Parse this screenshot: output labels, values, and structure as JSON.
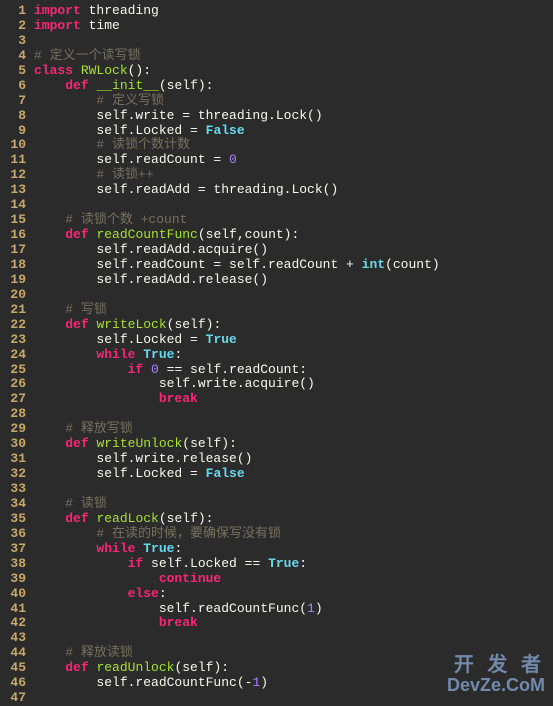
{
  "watermark": {
    "line1": "开 发 者",
    "line2": "DevZe.CoM"
  },
  "lines": [
    {
      "n": 1,
      "tokens": [
        [
          "import",
          "tok-import"
        ],
        [
          " threading",
          "tok-id"
        ]
      ]
    },
    {
      "n": 2,
      "tokens": [
        [
          "import",
          "tok-import"
        ],
        [
          " time",
          "tok-id"
        ]
      ]
    },
    {
      "n": 3,
      "tokens": []
    },
    {
      "n": 4,
      "tokens": [
        [
          "# 定义一个读写锁",
          "tok-comment"
        ]
      ]
    },
    {
      "n": 5,
      "tokens": [
        [
          "class ",
          "tok-deco"
        ],
        [
          "RWLock",
          "tok-def"
        ],
        [
          "():",
          "tok-paren"
        ]
      ]
    },
    {
      "n": 6,
      "tokens": [
        [
          "    ",
          ""
        ],
        [
          "def ",
          "tok-deco"
        ],
        [
          "__init__",
          "tok-def"
        ],
        [
          "(self):",
          "tok-paren"
        ]
      ]
    },
    {
      "n": 7,
      "tokens": [
        [
          "        ",
          ""
        ],
        [
          "# 定义写锁",
          "tok-comment"
        ]
      ]
    },
    {
      "n": 8,
      "tokens": [
        [
          "        self.write = threading.Lock()",
          "tok-id"
        ]
      ]
    },
    {
      "n": 9,
      "tokens": [
        [
          "        self.Locked = ",
          "tok-id"
        ],
        [
          "False",
          "tok-true"
        ]
      ]
    },
    {
      "n": 10,
      "tokens": [
        [
          "        ",
          ""
        ],
        [
          "# 读锁个数计数",
          "tok-comment"
        ]
      ]
    },
    {
      "n": 11,
      "tokens": [
        [
          "        self.readCount = ",
          "tok-id"
        ],
        [
          "0",
          "tok-num"
        ]
      ]
    },
    {
      "n": 12,
      "tokens": [
        [
          "        ",
          ""
        ],
        [
          "# 读锁++",
          "tok-comment"
        ]
      ]
    },
    {
      "n": 13,
      "tokens": [
        [
          "        self.readAdd = threading.Lock()",
          "tok-id"
        ]
      ]
    },
    {
      "n": 14,
      "tokens": []
    },
    {
      "n": 15,
      "tokens": [
        [
          "    ",
          ""
        ],
        [
          "# 读锁个数 +count",
          "tok-comment"
        ]
      ]
    },
    {
      "n": 16,
      "tokens": [
        [
          "    ",
          ""
        ],
        [
          "def ",
          "tok-deco"
        ],
        [
          "readCountFunc",
          "tok-def"
        ],
        [
          "(self,count):",
          "tok-paren"
        ]
      ]
    },
    {
      "n": 17,
      "tokens": [
        [
          "        self.readAdd.acquire()",
          "tok-id"
        ]
      ]
    },
    {
      "n": 18,
      "tokens": [
        [
          "        self.readCount = self.readCount + ",
          "tok-id"
        ],
        [
          "int",
          "tok-int"
        ],
        [
          "(count)",
          "tok-id"
        ]
      ]
    },
    {
      "n": 19,
      "tokens": [
        [
          "        self.readAdd.release()",
          "tok-id"
        ]
      ]
    },
    {
      "n": 20,
      "tokens": []
    },
    {
      "n": 21,
      "tokens": [
        [
          "    ",
          ""
        ],
        [
          "# 写锁",
          "tok-comment"
        ]
      ]
    },
    {
      "n": 22,
      "tokens": [
        [
          "    ",
          ""
        ],
        [
          "def ",
          "tok-deco"
        ],
        [
          "writeLock",
          "tok-def"
        ],
        [
          "(self):",
          "tok-paren"
        ]
      ]
    },
    {
      "n": 23,
      "tokens": [
        [
          "        self.Locked = ",
          "tok-id"
        ],
        [
          "True",
          "tok-true"
        ]
      ]
    },
    {
      "n": 24,
      "tokens": [
        [
          "        ",
          ""
        ],
        [
          "while ",
          "tok-flow"
        ],
        [
          "True",
          "tok-true"
        ],
        [
          ":",
          "tok-colon"
        ]
      ]
    },
    {
      "n": 25,
      "tokens": [
        [
          "            ",
          ""
        ],
        [
          "if ",
          "tok-flow"
        ],
        [
          "0",
          "tok-num"
        ],
        [
          " == self.readCount:",
          "tok-id"
        ]
      ]
    },
    {
      "n": 26,
      "tokens": [
        [
          "                self.write.acquire()",
          "tok-id"
        ]
      ]
    },
    {
      "n": 27,
      "tokens": [
        [
          "                ",
          ""
        ],
        [
          "break",
          "tok-flow"
        ]
      ]
    },
    {
      "n": 28,
      "tokens": []
    },
    {
      "n": 29,
      "tokens": [
        [
          "    ",
          ""
        ],
        [
          "# 释放写锁",
          "tok-comment"
        ]
      ]
    },
    {
      "n": 30,
      "tokens": [
        [
          "    ",
          ""
        ],
        [
          "def ",
          "tok-deco"
        ],
        [
          "writeUnlock",
          "tok-def"
        ],
        [
          "(self):",
          "tok-paren"
        ]
      ]
    },
    {
      "n": 31,
      "tokens": [
        [
          "        self.write.release()",
          "tok-id"
        ]
      ]
    },
    {
      "n": 32,
      "tokens": [
        [
          "        self.Locked = ",
          "tok-id"
        ],
        [
          "False",
          "tok-true"
        ]
      ]
    },
    {
      "n": 33,
      "tokens": []
    },
    {
      "n": 34,
      "tokens": [
        [
          "    ",
          ""
        ],
        [
          "# 读锁",
          "tok-comment"
        ]
      ]
    },
    {
      "n": 35,
      "tokens": [
        [
          "    ",
          ""
        ],
        [
          "def ",
          "tok-deco"
        ],
        [
          "readLock",
          "tok-def"
        ],
        [
          "(self):",
          "tok-paren"
        ]
      ]
    },
    {
      "n": 36,
      "tokens": [
        [
          "        ",
          ""
        ],
        [
          "# 在读的时候，要确保写没有锁",
          "tok-comment"
        ]
      ]
    },
    {
      "n": 37,
      "tokens": [
        [
          "        ",
          ""
        ],
        [
          "while ",
          "tok-flow"
        ],
        [
          "True",
          "tok-true"
        ],
        [
          ":",
          "tok-colon"
        ]
      ]
    },
    {
      "n": 38,
      "tokens": [
        [
          "            ",
          ""
        ],
        [
          "if ",
          "tok-flow"
        ],
        [
          "self.Locked == ",
          "tok-id"
        ],
        [
          "True",
          "tok-true"
        ],
        [
          ":",
          "tok-colon"
        ]
      ]
    },
    {
      "n": 39,
      "tokens": [
        [
          "                ",
          ""
        ],
        [
          "continue",
          "tok-flow"
        ]
      ]
    },
    {
      "n": 40,
      "tokens": [
        [
          "            ",
          ""
        ],
        [
          "else",
          "tok-flow"
        ],
        [
          ":",
          "tok-colon"
        ]
      ]
    },
    {
      "n": 41,
      "tokens": [
        [
          "                self.readCountFunc(",
          "tok-id"
        ],
        [
          "1",
          "tok-num"
        ],
        [
          ")",
          "tok-id"
        ]
      ]
    },
    {
      "n": 42,
      "tokens": [
        [
          "                ",
          ""
        ],
        [
          "break",
          "tok-flow"
        ]
      ]
    },
    {
      "n": 43,
      "tokens": []
    },
    {
      "n": 44,
      "tokens": [
        [
          "    ",
          ""
        ],
        [
          "# 释放读锁",
          "tok-comment"
        ]
      ]
    },
    {
      "n": 45,
      "tokens": [
        [
          "    ",
          ""
        ],
        [
          "def ",
          "tok-deco"
        ],
        [
          "readUnlock",
          "tok-def"
        ],
        [
          "(self):",
          "tok-paren"
        ]
      ]
    },
    {
      "n": 46,
      "tokens": [
        [
          "        self.readCountFunc(-",
          "tok-id"
        ],
        [
          "1",
          "tok-num"
        ],
        [
          ")",
          "tok-id"
        ]
      ]
    },
    {
      "n": 47,
      "tokens": []
    }
  ]
}
